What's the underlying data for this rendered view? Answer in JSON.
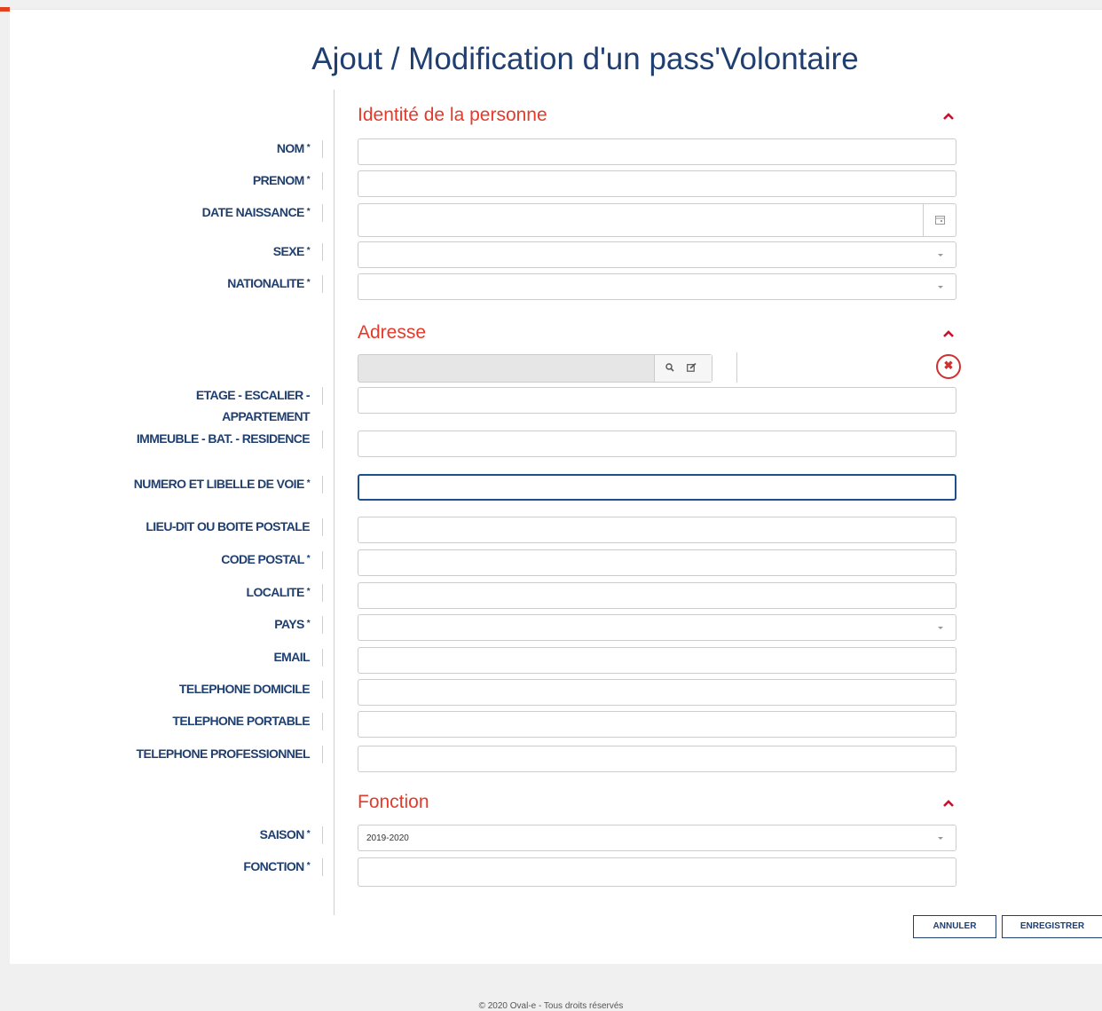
{
  "title": "Ajout / Modification d'un pass'Volontaire",
  "required_mark": "*",
  "sections": {
    "identite": {
      "title": "Identité de la personne"
    },
    "adresse": {
      "title": "Adresse"
    },
    "fonction": {
      "title": "Fonction"
    }
  },
  "fields": {
    "nom": {
      "label": "NOM",
      "value": ""
    },
    "prenom": {
      "label": "PRENOM",
      "value": ""
    },
    "date_naissance": {
      "label": "DATE NAISSANCE",
      "value": ""
    },
    "sexe": {
      "label": "SEXE",
      "value": ""
    },
    "nationalite": {
      "label": "NATIONALITE",
      "value": ""
    },
    "adresse_recherche": {
      "value": ""
    },
    "etage": {
      "label": "ETAGE - ESCALIER - APPARTEMENT",
      "value": ""
    },
    "immeuble": {
      "label": "IMMEUBLE - BAT. - RESIDENCE",
      "value": ""
    },
    "numero_voie": {
      "label": "NUMERO ET LIBELLE DE VOIE",
      "value": ""
    },
    "lieu_dit": {
      "label": "LIEU-DIT OU BOITE POSTALE",
      "value": ""
    },
    "code_postal": {
      "label": "CODE POSTAL",
      "value": ""
    },
    "localite": {
      "label": "LOCALITE",
      "value": ""
    },
    "pays": {
      "label": "PAYS",
      "value": ""
    },
    "email": {
      "label": "EMAIL",
      "value": ""
    },
    "tel_domicile": {
      "label": "TELEPHONE DOMICILE",
      "value": ""
    },
    "tel_portable": {
      "label": "TELEPHONE PORTABLE",
      "value": ""
    },
    "tel_pro": {
      "label": "TELEPHONE PROFESSIONNEL",
      "value": ""
    },
    "saison": {
      "label": "SAISON",
      "value": "2019-2020"
    },
    "fonction": {
      "label": "FONCTION",
      "value": ""
    }
  },
  "buttons": {
    "cancel": "ANNULER",
    "save": "ENREGISTRER"
  },
  "footer": "© 2020 Oval-e - Tous droits réservés",
  "colors": {
    "label": "#1f3f70",
    "section": "#e53a2a",
    "accent": "#e2431e"
  }
}
